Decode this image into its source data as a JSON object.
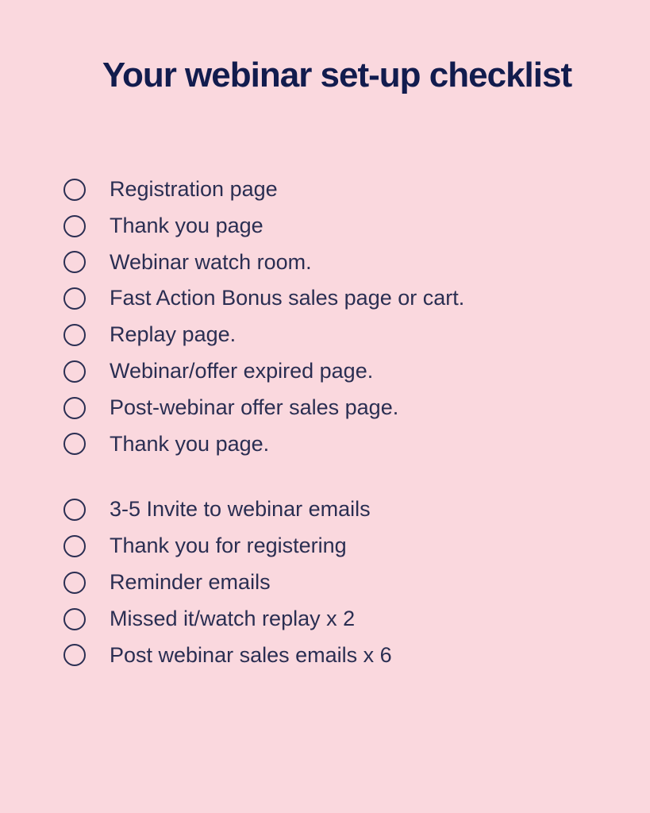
{
  "title": "Your webinar set-up checklist",
  "group1": {
    "items": [
      "Registration page",
      "Thank you page",
      "Webinar watch room.",
      "Fast Action Bonus sales page or cart.",
      "Replay page.",
      "Webinar/offer expired page.",
      "Post-webinar offer sales page.",
      "Thank you page."
    ]
  },
  "group2": {
    "items": [
      "3-5 Invite to webinar emails",
      "Thank you for registering",
      "Reminder emails",
      "Missed it/watch replay x 2",
      "Post webinar sales emails x 6"
    ]
  }
}
